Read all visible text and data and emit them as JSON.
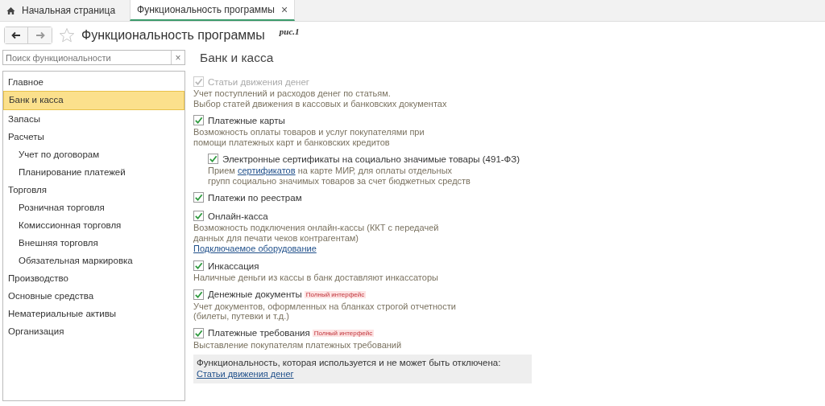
{
  "tabs": [
    {
      "label": "Начальная страница",
      "kind": "home",
      "selected": false
    },
    {
      "label": "Функциональность программы",
      "kind": "page",
      "selected": true,
      "close": "×"
    }
  ],
  "header": {
    "title": "Функциональность программы",
    "caption": "рис.1"
  },
  "search": {
    "placeholder": "Поиск функциональности",
    "clear": "×"
  },
  "sidebar": {
    "items": [
      {
        "label": "Главное",
        "selected": false
      },
      {
        "label": "Банк и касса",
        "selected": true
      },
      {
        "label": "Запасы",
        "selected": false
      },
      {
        "label": "Расчеты",
        "selected": false,
        "children": [
          {
            "label": "Учет по договорам",
            "selected": false
          },
          {
            "label": "Планирование платежей",
            "selected": false
          }
        ]
      },
      {
        "label": "Торговля",
        "selected": false,
        "children": [
          {
            "label": "Розничная торговля",
            "selected": false
          },
          {
            "label": "Комиссионная торговля",
            "selected": false
          },
          {
            "label": "Внешняя торговля",
            "selected": false
          },
          {
            "label": "Обязательная маркировка",
            "selected": false
          }
        ]
      },
      {
        "label": "Производство",
        "selected": false
      },
      {
        "label": "Основные средства",
        "selected": false
      },
      {
        "label": "Нематериальные активы",
        "selected": false
      },
      {
        "label": "Организация",
        "selected": false
      }
    ]
  },
  "section": {
    "title": "Банк и касса",
    "options": [
      {
        "label": "Статьи движения денег",
        "checked": true,
        "disabled": true,
        "description": [
          "Учет поступлений и расходов денег по статьям.",
          "Выбор статей движения в кассовых и банковских документах"
        ]
      },
      {
        "label": "Платежные карты",
        "checked": true,
        "disabled": false,
        "description": [
          "Возможность оплаты товаров и услуг покупателями при",
          "помощи платежных карт и банковских кредитов"
        ],
        "children": [
          {
            "label": "Электронные сертификаты на социально значимые товары (491-ФЗ)",
            "checked": true,
            "disabled": false,
            "description": [
              [
                {
                  "text": "Прием ",
                  "link": false
                },
                {
                  "text": "сертификатов",
                  "link": true
                },
                {
                  "text": " на карте МИР, для оплаты отдельных",
                  "link": false
                }
              ],
              "групп социально значимых товаров за счет бюджетных средств"
            ]
          }
        ]
      },
      {
        "label": "Платежи по реестрам",
        "checked": true,
        "disabled": false
      },
      {
        "label": "Онлайн-касса",
        "checked": true,
        "disabled": false,
        "description": [
          "Возможность подключения онлайн-кассы (ККТ с передачей",
          "данных для печати чеков контрагентам)"
        ],
        "link": "Подключаемое оборудование"
      },
      {
        "label": "Инкассация",
        "checked": true,
        "disabled": false,
        "description": [
          "Наличные деньги из кассы в банк доставляют инкассаторы"
        ]
      },
      {
        "label": "Денежные документы",
        "checked": true,
        "disabled": false,
        "badge": "Полный интерфейс",
        "description": [
          "Учет документов, оформленных на бланках строгой отчетности",
          "(билеты, путевки и т.д.)"
        ]
      },
      {
        "label": "Платежные требования",
        "checked": true,
        "disabled": false,
        "badge": "Полный интерфейс",
        "description": [
          "Выставление покупателям платежных требований"
        ]
      }
    ],
    "note": {
      "text": "Функциональность, которая используется и не может быть отключена:",
      "link": "Статьи движения денег"
    }
  }
}
